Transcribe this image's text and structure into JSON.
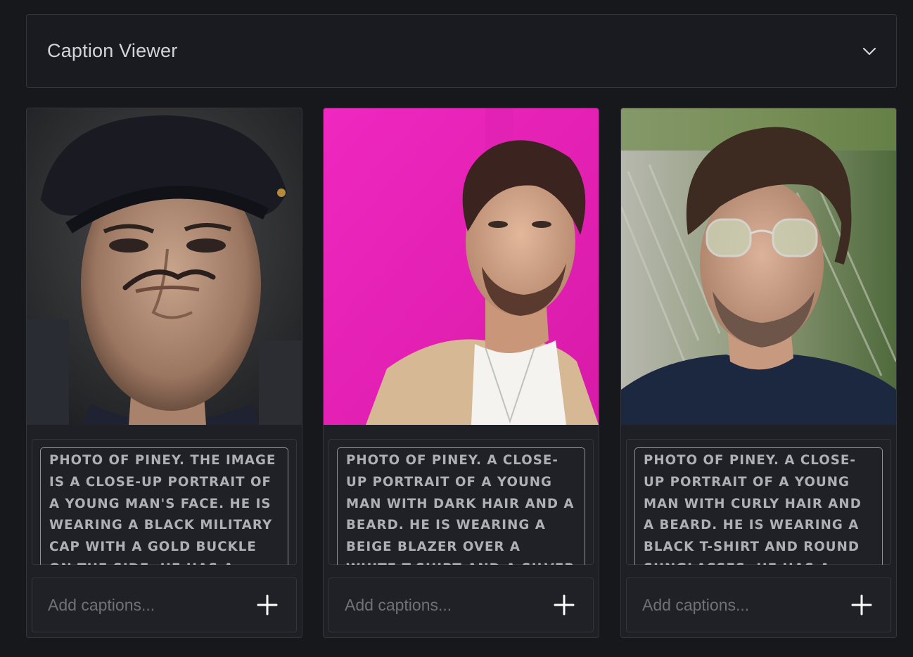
{
  "header": {
    "title": "Caption Viewer",
    "toggle_icon": "chevron-down-icon"
  },
  "cards": [
    {
      "image_alt": "Portrait of a young man wearing a black military cap",
      "caption": "PHOTO OF PINEY. THE IMAGE IS A CLOSE-UP PORTRAIT OF A YOUNG MAN'S FACE. HE IS WEARING A BLACK MILITARY CAP WITH A GOLD BUCKLE ON THE SIDE. HE HAS A",
      "add_placeholder": "Add captions...",
      "add_icon": "plus-icon"
    },
    {
      "image_alt": "Young man with dark hair in a beige blazer on a pink background",
      "caption": "PHOTO OF PINEY. A CLOSE-UP PORTRAIT OF A YOUNG MAN WITH DARK HAIR AND A BEARD. HE IS WEARING A BEIGE BLAZER OVER A WHITE T-SHIRT AND A SILVER",
      "add_placeholder": "Add captions...",
      "add_icon": "plus-icon"
    },
    {
      "image_alt": "Young man with curly hair and round sunglasses outdoors",
      "caption": "PHOTO OF PINEY. A CLOSE-UP PORTRAIT OF A YOUNG MAN WITH CURLY HAIR AND A BEARD. HE IS WEARING A BLACK T-SHIRT AND ROUND SUNGLASSES. HE HAS A",
      "add_placeholder": "Add captions...",
      "add_icon": "plus-icon"
    }
  ],
  "colors": {
    "background": "#17181c",
    "panel": "#1f2025",
    "border": "#33353b",
    "caption_text": "#aeb0b6",
    "pink_backdrop": "#ea20b6"
  }
}
